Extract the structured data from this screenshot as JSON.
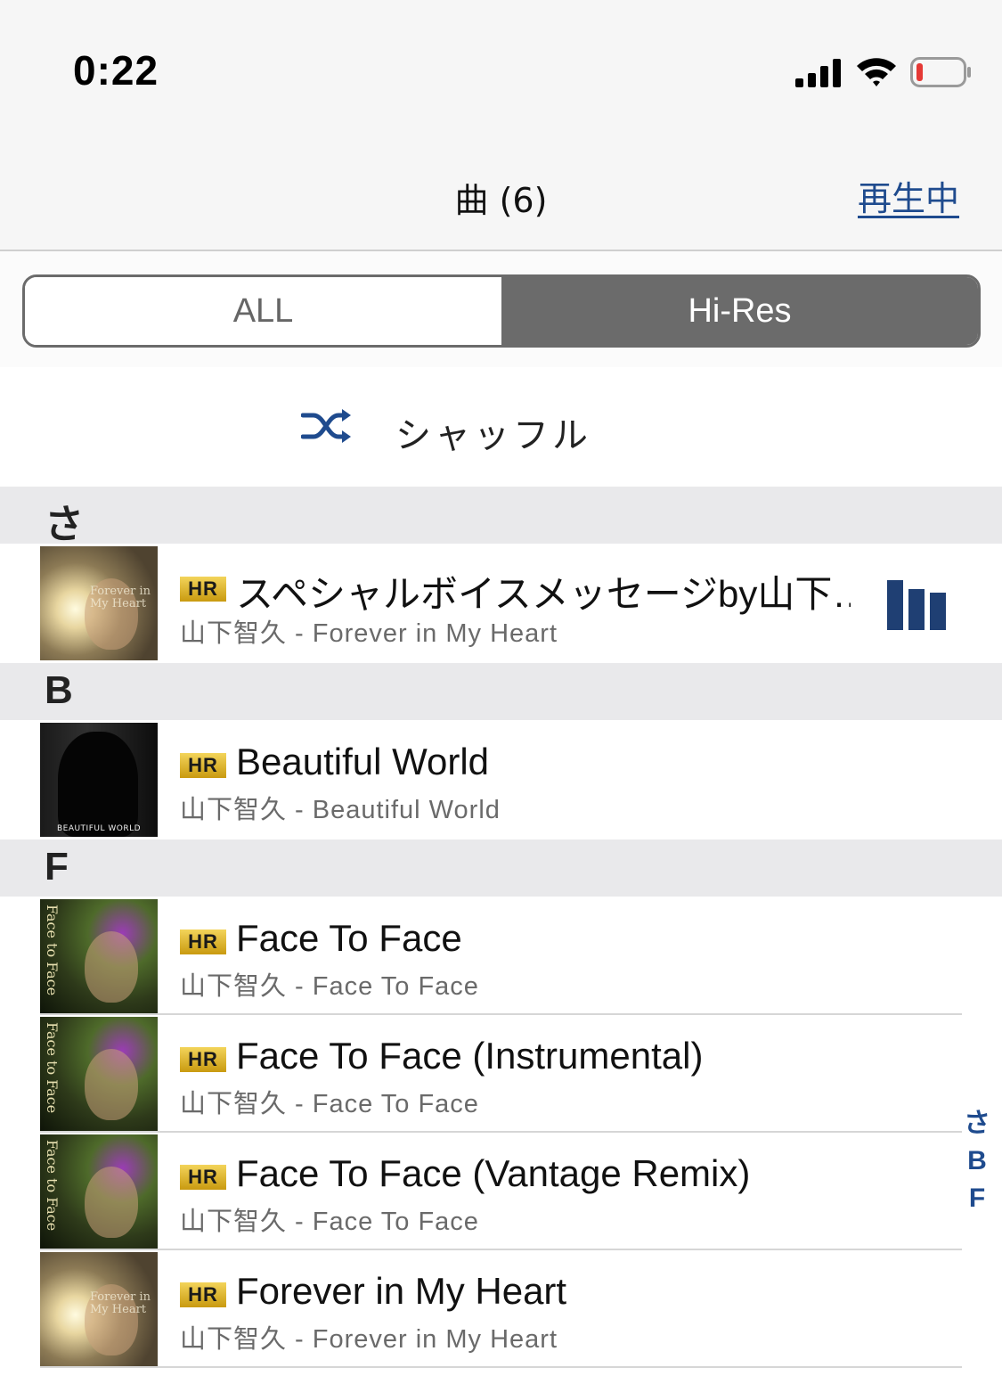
{
  "status_bar": {
    "time": "0:22",
    "icons": [
      "signal-icon",
      "wifi-icon",
      "battery-icon"
    ],
    "battery_color": "#e53935"
  },
  "nav": {
    "title": "曲 (6)",
    "now_playing_label": "再生中"
  },
  "segments": {
    "all_label": "ALL",
    "hires_label": "Hi-Res",
    "selected": "Hi-Res"
  },
  "shuffle": {
    "label": "シャッフル",
    "icon": "shuffle-icon"
  },
  "sections": [
    {
      "letter": "さ",
      "tracks": [
        {
          "badge": "HR",
          "title": "スペシャルボイスメッセージby山下…",
          "subtitle": "山下智久 - Forever in My Heart",
          "art_text": "Forever in My Heart",
          "playing": true
        }
      ]
    },
    {
      "letter": "B",
      "tracks": [
        {
          "badge": "HR",
          "title": "Beautiful World",
          "subtitle": "山下智久 - Beautiful World",
          "art_text": "BEAUTIFUL WORLD",
          "playing": false
        }
      ]
    },
    {
      "letter": "F",
      "tracks": [
        {
          "badge": "HR",
          "title": "Face To Face",
          "subtitle": "山下智久 - Face To Face",
          "art_text": "Face to Face",
          "playing": false
        },
        {
          "badge": "HR",
          "title": "Face To Face (Instrumental)",
          "subtitle": "山下智久 - Face To Face",
          "art_text": "Face to Face",
          "playing": false
        },
        {
          "badge": "HR",
          "title": "Face To Face (Vantage Remix)",
          "subtitle": "山下智久 - Face To Face",
          "art_text": "Face to Face",
          "playing": false
        },
        {
          "badge": "HR",
          "title": "Forever in My Heart",
          "subtitle": "山下智久 - Forever in My Heart",
          "art_text": "Forever in My Heart",
          "playing": false
        }
      ]
    }
  ],
  "index": [
    "さ",
    "B",
    "F"
  ],
  "colors": {
    "accent": "#1f4b8e",
    "segment_selected": "#6b6b6b",
    "section_bg": "#e9e9eb",
    "hr_badge": "#e2b62a"
  }
}
